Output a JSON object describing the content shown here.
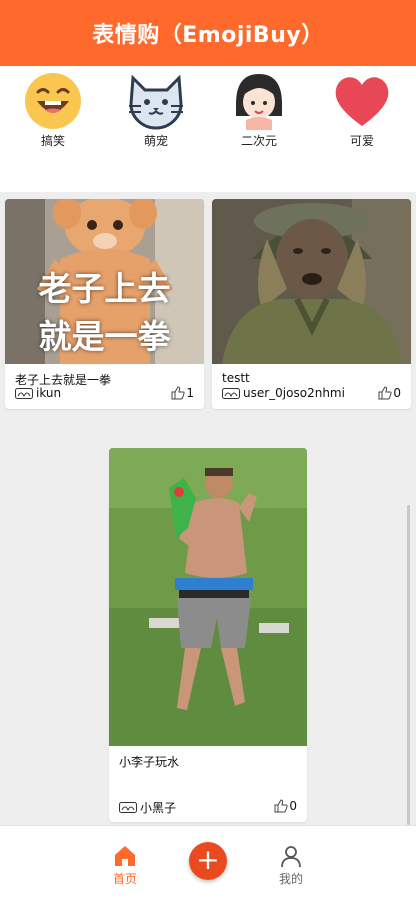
{
  "header": {
    "title": "表情购（EmojiBuy）"
  },
  "categories": [
    {
      "label": "搞笑",
      "icon": "laughing-face-icon"
    },
    {
      "label": "萌宠",
      "icon": "cat-face-icon"
    },
    {
      "label": "二次元",
      "icon": "anime-girl-icon"
    },
    {
      "label": "可爱",
      "icon": "heart-icon"
    }
  ],
  "posts": [
    {
      "image_caption": [
        "老子上去",
        "就是一拳"
      ],
      "title": "老子上去就是一拳",
      "author": "ikun",
      "likes": "1"
    },
    {
      "title": "testt",
      "author": "user_0joso2nhmi",
      "likes": "0"
    },
    {
      "title": "小李子玩水",
      "author": "小黑子",
      "likes": "0"
    }
  ],
  "bottom_nav": {
    "home_label": "首页",
    "publish_symbol": "+",
    "me_label": "我的"
  },
  "colors": {
    "brand": "#ff6a2c",
    "publish": "#ea4a1f"
  }
}
